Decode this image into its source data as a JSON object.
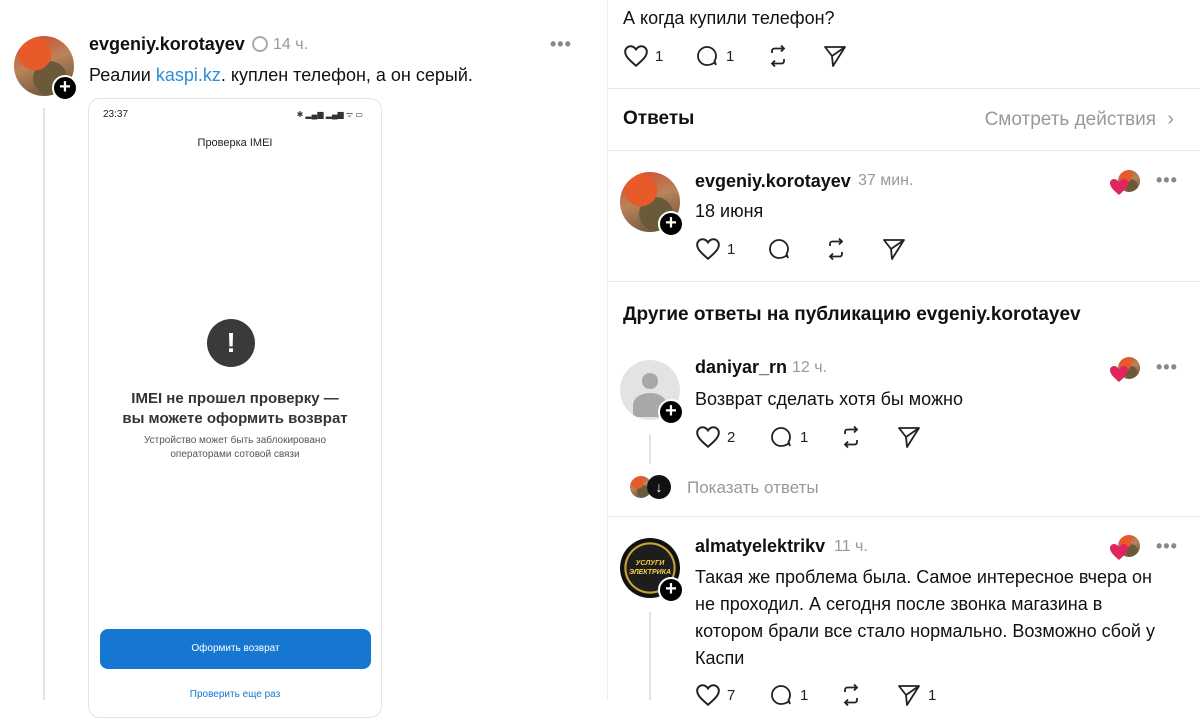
{
  "post": {
    "username": "evgeniy.korotayev",
    "time": "14 ч.",
    "more": "•••",
    "text_before_link": "Реалии ",
    "link": "kaspi.kz",
    "text_after_link": ".  куплен телефон, а он серый."
  },
  "phone": {
    "time": "23:37",
    "status": "✱ ▂▄▆ ▂▄▆ ᯤ ▭",
    "title": "Проверка IMEI",
    "icon": "!",
    "heading_line1": "IMEI не прошел проверку —",
    "heading_line2": "вы можете оформить возврат",
    "sub_line1": "Устройство может быть заблокировано",
    "sub_line2": "операторами сотовой связи",
    "button": "Оформить возврат",
    "link": "Проверить еще раз"
  },
  "top_reply": {
    "text": "А когда купили телефон?",
    "likes": "1",
    "comments": "1"
  },
  "answers_header": {
    "title": "Ответы",
    "activity": "Смотреть действия"
  },
  "reply1": {
    "username": "evgeniy.korotayev",
    "time": "37 мин.",
    "text": "18 июня",
    "likes": "1",
    "more": "•••"
  },
  "other_header": "Другие ответы на публикацию evgeniy.korotayev",
  "reply2": {
    "username": "daniyar_rn",
    "time": "12 ч.",
    "text": "Возврат сделать хотя бы можно",
    "likes": "2",
    "comments": "1",
    "more": "•••",
    "show_replies": "Показать ответы"
  },
  "reply3": {
    "username": "almatyelektrikv",
    "time": "11 ч.",
    "logo_line1": "УСЛУГИ",
    "logo_line2": "ЭЛЕКТРИКА",
    "line1": "Такая же проблема была. Самое интересное вчера он",
    "line2": "не проходил. А сегодня после звонка магазина в",
    "line3": "котором брали все стало нормально. Возможно сбой у",
    "line4": "Каспи",
    "likes": "7",
    "comments": "1",
    "shares": "1",
    "more": "•••"
  },
  "colors": {
    "link": "#2a8fd8",
    "button": "#1577d2",
    "heart": "#e0245e"
  }
}
